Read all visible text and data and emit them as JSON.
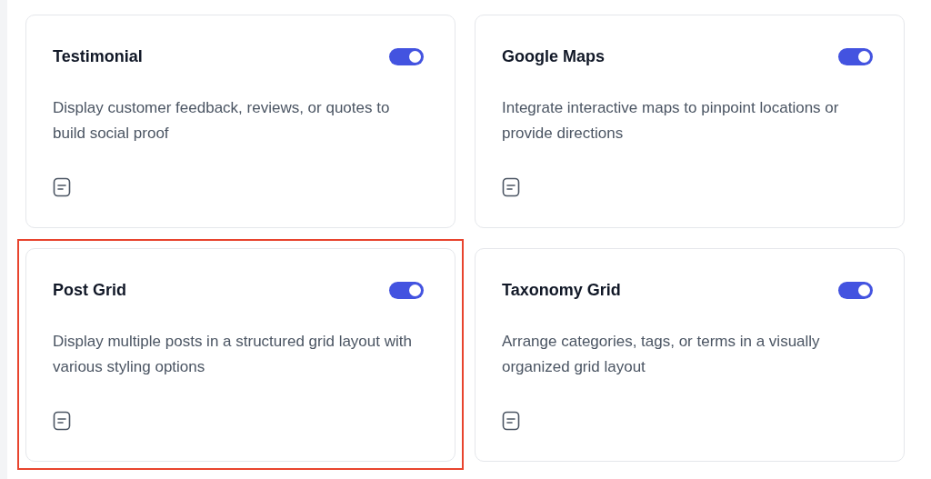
{
  "cards": [
    {
      "title": "Testimonial",
      "description": "Display customer feedback, reviews, or quotes to build social proof",
      "on": true,
      "highlighted": false
    },
    {
      "title": "Google Maps",
      "description": "Integrate interactive maps to pinpoint locations or provide directions",
      "on": true,
      "highlighted": false
    },
    {
      "title": "Post Grid",
      "description": "Display multiple posts in a structured grid layout with various styling options",
      "on": true,
      "highlighted": true
    },
    {
      "title": "Taxonomy Grid",
      "description": "Arrange categories, tags, or terms in a visually organized grid layout",
      "on": true,
      "highlighted": false
    }
  ]
}
